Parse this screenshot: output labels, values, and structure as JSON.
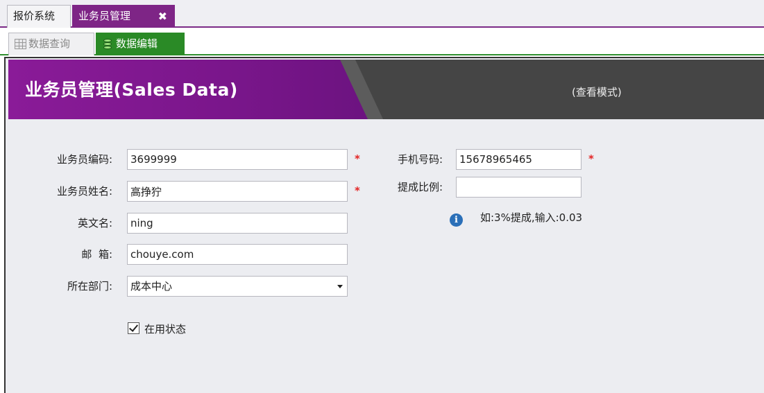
{
  "top_tabs": [
    {
      "label": "报价系统"
    },
    {
      "label": "业务员管理",
      "close": "✖"
    }
  ],
  "sub_tabs": [
    {
      "label": "数据查询",
      "icon": "grid-icon"
    },
    {
      "label": "数据编辑",
      "icon": "database-edit-icon"
    }
  ],
  "banner": {
    "title": "业务员管理(Sales Data)",
    "mode": "(查看模式)",
    "colors": {
      "purple": "#8a1b98",
      "dark": "#454545"
    }
  },
  "form": {
    "code": {
      "label": "业务员编码:",
      "value": "3699999",
      "required": "*"
    },
    "name": {
      "label": "业务员姓名:",
      "value": "高挣狞",
      "required": "*"
    },
    "english_name": {
      "label": "英文名:",
      "value": "ning"
    },
    "email": {
      "label": "邮  箱:",
      "value": "chouye.com"
    },
    "department": {
      "label": "所在部门:",
      "value": "成本中心"
    },
    "phone": {
      "label": "手机号码:",
      "value": "15678965465",
      "required": "*"
    },
    "commission": {
      "label": "提成比例:",
      "value": ""
    },
    "hint": "如:3%提成,输入:0.03",
    "active": {
      "label": "在用状态",
      "checked": true
    }
  }
}
